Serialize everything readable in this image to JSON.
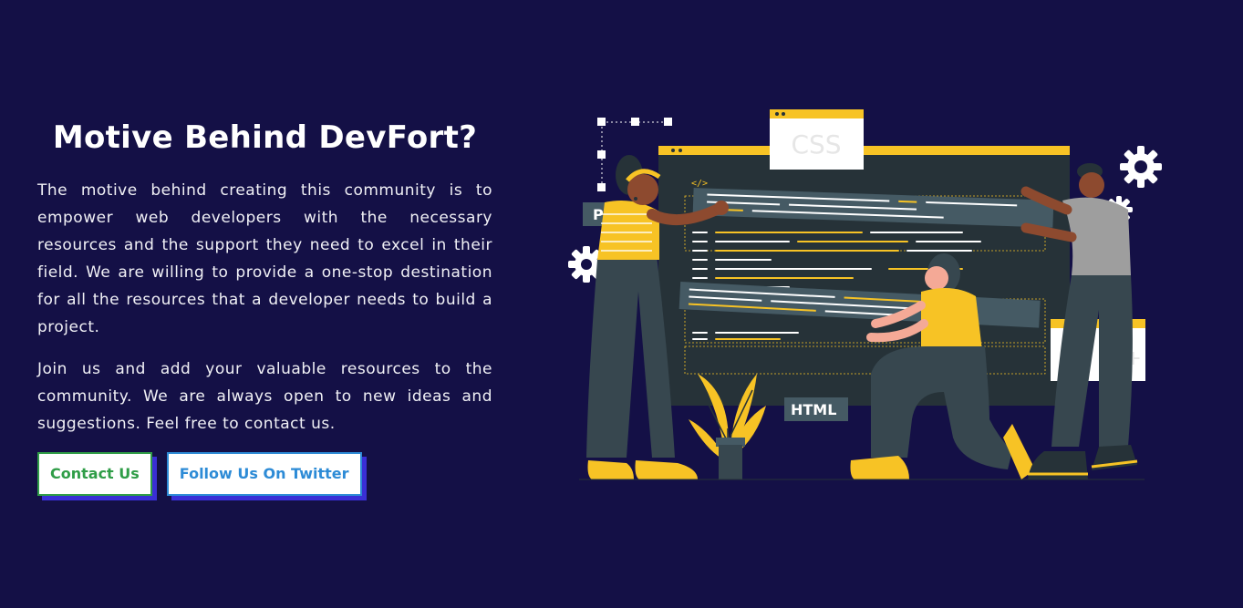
{
  "section": {
    "title": "Motive Behind DevFort?",
    "paragraph1": "The motive behind creating this community is to empower web developers with the necessary resources and the support they need to excel in their field. We are willing to provide a one-stop destination for all the resources that a developer needs to build a project.",
    "paragraph2": "Join us and add your valuable resources to the community. We are always open to new ideas and suggestions. Feel free to contact us."
  },
  "buttons": {
    "contact_label": "Contact Us",
    "twitter_label": "Follow Us On Twitter"
  },
  "illustration": {
    "css_label": "CSS",
    "php_label": "PHP",
    "html_label": "HTML",
    "code_glyph": "</>"
  },
  "colors": {
    "background": "#141046",
    "accent_yellow": "#f7c325",
    "screen": "#263238",
    "contact_green": "#2f9d47",
    "twitter_blue": "#2d8bd6",
    "button_shadow": "#3a2fd6"
  }
}
